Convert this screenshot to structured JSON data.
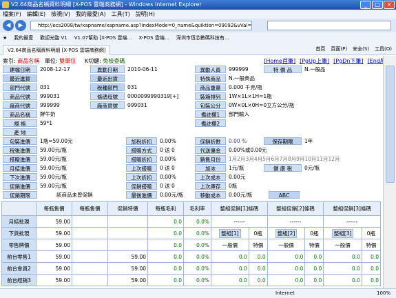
{
  "window": {
    "title": "V2.64商品名稱資料明細 [X-POS 雲端商務網] - Windows Internet Explorer"
  },
  "menu": [
    "檔案(F)",
    "編輯(E)",
    "檢視(V)",
    "我的最愛(A)",
    "工具(T)",
    "說明(H)"
  ],
  "address": {
    "url": "http://ecs2008/tw/xapname/xapname.asp?IndexMode=0_name&quiktion=09092&vVal=鮮牛奶"
  },
  "favorites": {
    "label": "我的最愛",
    "items": [
      "歡迎光臨 V1",
      "V1.07幫助 [X-POS 雲端…",
      "X-POS 雲端…",
      "深圳市恆芯數碼科技有…"
    ]
  },
  "tab": {
    "label": "V2.64商品名稱資料明細 [X-POS 雲端商務網]"
  },
  "tabtools": [
    "首頁",
    "頁面(P)",
    "安全(S)",
    "工具(O)"
  ],
  "form": {
    "index_label": "索引:",
    "index_value": "商品名稱",
    "unit_label": "單位:",
    "unit_value": "雙單位",
    "kcode_label": "K切鍵:",
    "kcode_value": "免檢查碼",
    "nav": [
      "[Home首筆]",
      "[PgUp上筆]",
      "[PgDn下筆]",
      "[End尾筆]"
    ]
  },
  "fields": {
    "build_date_l": "建檔日期",
    "build_date": "2008-12-17",
    "change_date_l": "異動日期",
    "change_date": "2010-06-11",
    "change_user_l": "異動人員",
    "change_user": "999999",
    "special_l": "特 價 品",
    "special": "N.一般品",
    "last_in_l": "最近進貨",
    "last_out_l": "最近出貨",
    "special_goods_l": "特殊商品",
    "special_goods": "N.一般商品",
    "dept_l": "部門代號",
    "dept": "031",
    "tax_dept_l": "稅種部門",
    "tax_dept": "031",
    "weight_l": "商品重量",
    "weight": "0.000 千克/瓶",
    "goods_code_l": "商品代號",
    "goods_code": "999031",
    "barcode_l": "條碼母號",
    "barcode": "0000099990319[+]",
    "pack_l": "裝箱排列",
    "pack": "1W×1L×1H=1瓶",
    "vendor_l": "廠商代號",
    "vendor": "999999",
    "vendor_goods_l": "廠商貨號",
    "vendor_goods": "099031",
    "volume_l": "包裝公分",
    "volume": "0W×0L×0H=0立方公分/瓶",
    "name_l": "商品名稱",
    "name": "鮮牛奶",
    "remark1_l": "備註欄1",
    "remark1": "部門輸入",
    "spec_l": "規 格",
    "spec": "59*1",
    "remark2_l": "備註欄2",
    "origin_l": "產 地",
    "pack_in_l": "包裝進價",
    "pack_in": "1瓶=59.00元",
    "tax_inclusive_l": "加稅折扣",
    "tax_inclusive": "0.00%",
    "promo_disc_l": "促銷折數",
    "promo_disc": "0.00 %",
    "keep_l": "保存期限",
    "keep": "1年",
    "pre_tax_l": "稅後進價",
    "pre_tax": "59.00元/瓶",
    "pickup_mode_l": "搭贈方式",
    "pickup_mode": "0 送 0",
    "agent_fee_l": "代送傭金",
    "agent_fee": "0.00%或0.00元",
    "pick_in_l": "搭贈進價",
    "pick_in": "59.00元/瓶",
    "pick_disc_l": "搭贈折扣",
    "pick_disc": "0.00%",
    "sale_month_l": "銷售月份",
    "sale_month": "1月2月3月4月5月6月7月8月9月10月11月12月",
    "month_in_l": "月結進價",
    "month_in": "59.00元/瓶",
    "last_pick_l": "上次搭贈",
    "last_pick": "0 送 0",
    "ice_l": "加冰",
    "ice": "1元/瓶",
    "health_tax_l": "健 康 稅",
    "health_tax": "0元/瓶",
    "next_in_l": "下次進價",
    "next_in": "59.00元/瓶",
    "last_disc_l": "上次折扣",
    "last_disc": "0.00%",
    "last_cost_l": "上次成本",
    "last_cost": "0.00元",
    "promo_in_l": "促銷進價",
    "promo_in": "59.00元/瓶",
    "promo_pick_l": "促銷搭贈",
    "promo_pick": "0 送 0",
    "last_stock_l": "上次庫存",
    "last_stock": "0瓶",
    "promo_period_l": "促銷期限",
    "promo_period": "該商品未曾促銷",
    "min_in_l": "最後進價",
    "min_in": "0.00元/瓶",
    "move_cost_l": "移動成本",
    "move_cost": "0.00元/瓶",
    "abc": "ABC"
  },
  "grid": {
    "headers": [
      "",
      "每瓶售價",
      "每瓶售價",
      "促銷特價",
      "每瓶毛利",
      "毛利率",
      "整組促銷[1]條碼",
      "",
      "整組促銷[2]條碼",
      "",
      "整組促銷[3]條碼",
      ""
    ],
    "rows": [
      {
        "label": "月結批現",
        "cells": [
          "59.00",
          "",
          "",
          "0.0",
          "0.0%",
          "------",
          "",
          "------",
          "",
          "------",
          ""
        ]
      },
      {
        "label": "下貨批現",
        "cells": [
          "59.00",
          "",
          "",
          "0.0",
          "0.0%",
          "整組[1]",
          "0瓶",
          "整組[2]",
          "0瓶",
          "整組[3]",
          "0瓶"
        ]
      },
      {
        "label": "零售牌價",
        "cells": [
          "59.00",
          "",
          "",
          "0.0",
          "0.0%",
          "一般價",
          "特價",
          "一般價",
          "特價",
          "一般價",
          "特價"
        ]
      },
      {
        "label": "前台零售1",
        "cells": [
          "59.00",
          "",
          "59.00",
          "0.0",
          "0.0%",
          "0.0",
          "0.0",
          "0.0",
          "0.0",
          "0.0",
          "0.0"
        ]
      },
      {
        "label": "前台會員2",
        "cells": [
          "59.00",
          "",
          "59.00",
          "0.0",
          "0.0%",
          "0.0",
          "0.0",
          "0.0",
          "0.0",
          "0.0",
          "0.0"
        ]
      },
      {
        "label": "前台經銷3",
        "cells": [
          "59.00",
          "",
          "59.00",
          "0.0",
          "0.0%",
          "0.0",
          "0.0",
          "0.0",
          "0.0",
          "0.0",
          "0.0"
        ]
      }
    ]
  },
  "status": {
    "zone": "Internet",
    "zoom": "100%"
  }
}
